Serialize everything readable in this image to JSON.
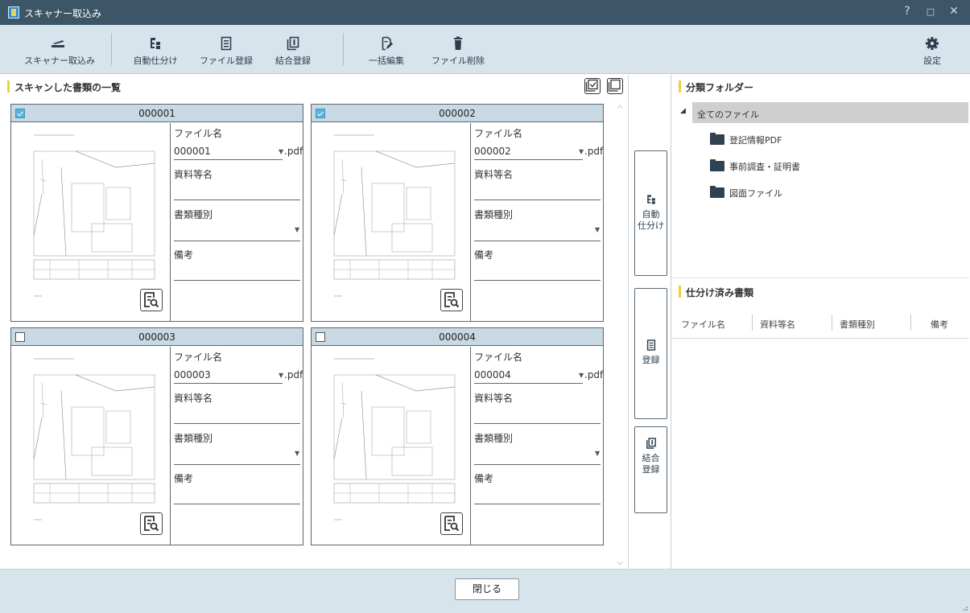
{
  "window": {
    "title": "スキャナー取込み",
    "help": "?",
    "maximize": "□",
    "close": "✕"
  },
  "toolbar": {
    "scan": "スキャナー取込み",
    "auto_sort": "自動仕分け",
    "file_register": "ファイル登録",
    "merge_register": "結合登録",
    "bulk_edit": "一括編集",
    "file_delete": "ファイル削除",
    "settings": "設定"
  },
  "left": {
    "title": "スキャンした書類の一覧"
  },
  "cards": [
    {
      "number": "000001",
      "checked": true,
      "filename": "000001",
      "ext": ".pdf",
      "label_filename": "ファイル名",
      "label_docname": "資料等名",
      "label_type": "書類種別",
      "label_note": "備考"
    },
    {
      "number": "000002",
      "checked": true,
      "filename": "000002",
      "ext": ".pdf",
      "label_filename": "ファイル名",
      "label_docname": "資料等名",
      "label_type": "書類種別",
      "label_note": "備考"
    },
    {
      "number": "000003",
      "checked": false,
      "filename": "000003",
      "ext": ".pdf",
      "label_filename": "ファイル名",
      "label_docname": "資料等名",
      "label_type": "書類種別",
      "label_note": "備考"
    },
    {
      "number": "000004",
      "checked": false,
      "filename": "000004",
      "ext": ".pdf",
      "label_filename": "ファイル名",
      "label_docname": "資料等名",
      "label_type": "書類種別",
      "label_note": "備考"
    }
  ],
  "side": {
    "auto_sort_1": "自動",
    "auto_sort_2": "仕分け",
    "register": "登録",
    "merge_1": "結合",
    "merge_2": "登録"
  },
  "right": {
    "folders_title": "分類フォルダー",
    "tree_root": "全てのファイル",
    "folders": [
      "登記情報PDF",
      "事前調査・証明書",
      "図面ファイル"
    ],
    "sorted_title": "仕分け済み書類",
    "columns": [
      "ファイル名",
      "資料等名",
      "書類種別",
      "備考"
    ]
  },
  "footer": {
    "close": "閉じる"
  },
  "colors": {
    "titlebar": "#3c5567",
    "toolbar": "#d8e4ec",
    "card_header": "#c9d9e4",
    "accent": "#f0cf3a",
    "check": "#5ab3dc"
  }
}
